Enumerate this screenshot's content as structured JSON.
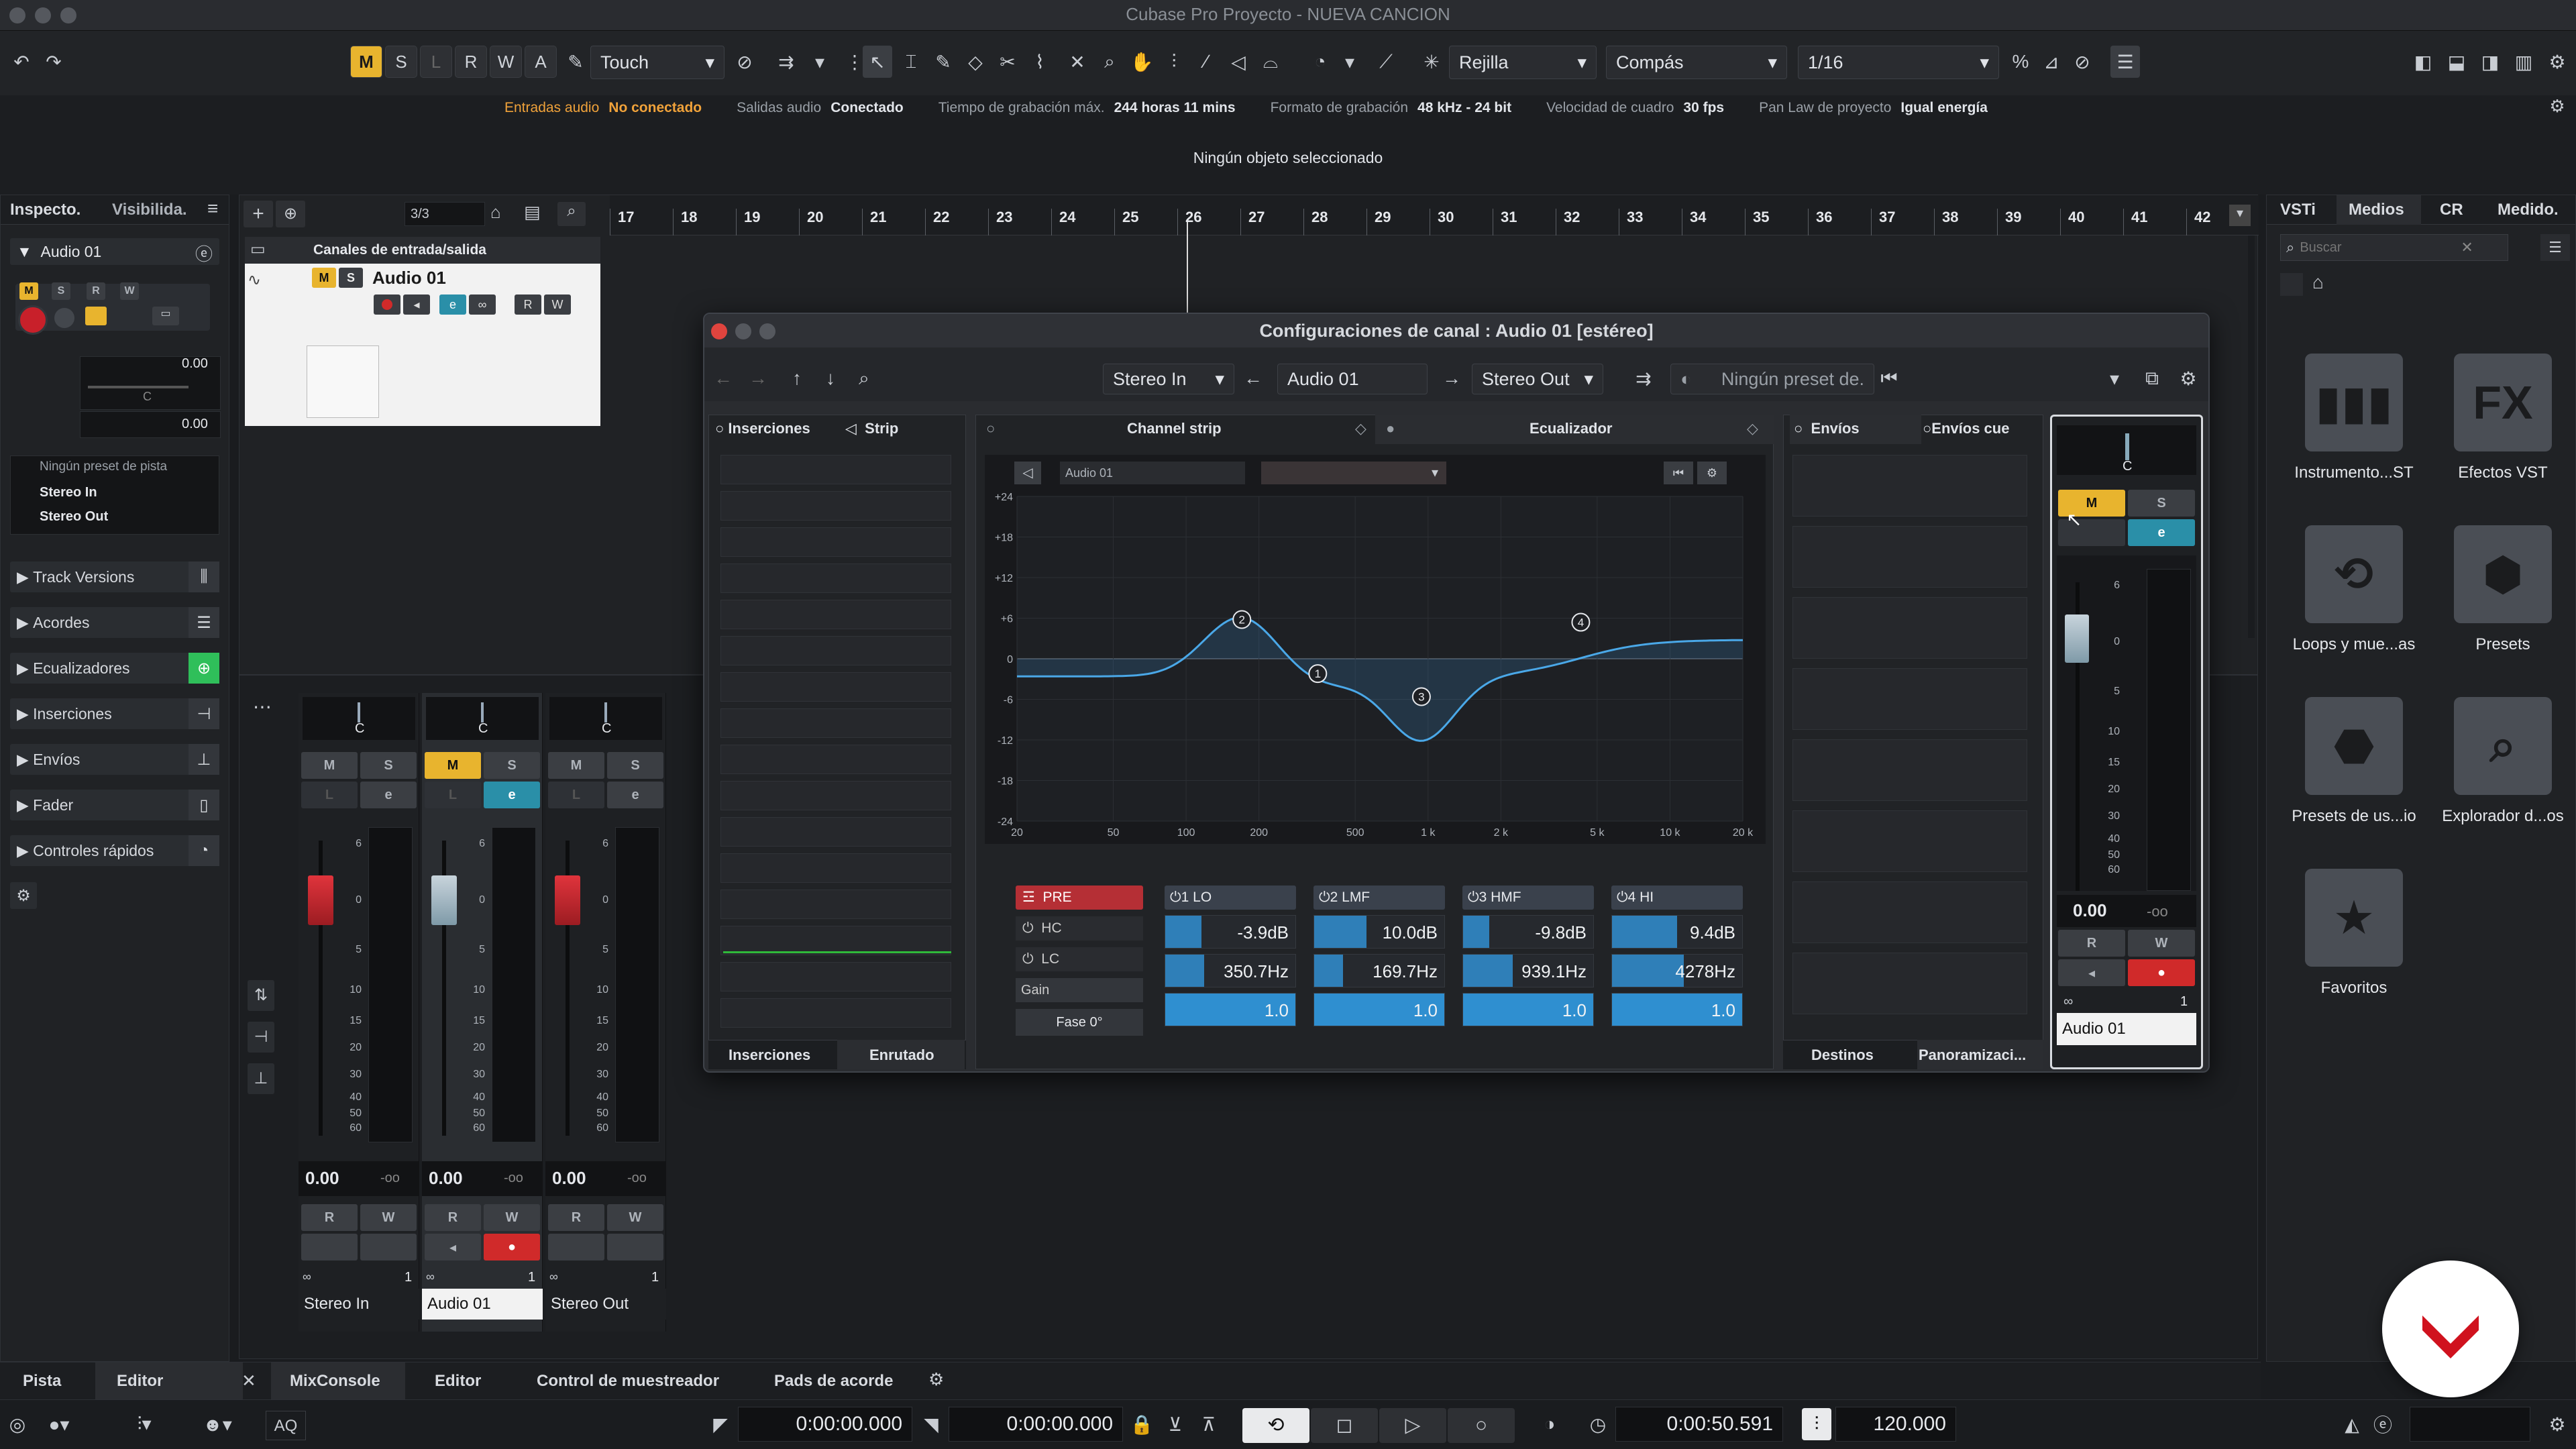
{
  "titlebar": {
    "title": "Cubase Pro Proyecto - NUEVA CANCION"
  },
  "toolbar": {
    "buttons_msrwa": [
      "M",
      "S",
      "L",
      "R",
      "W",
      "A"
    ],
    "automation_mode": "Touch",
    "grid_type": "Rejilla",
    "grid_mode": "Compás",
    "quantize": "1/16"
  },
  "status": {
    "audio_in_label": "Entradas audio",
    "audio_in_value": "No conectado",
    "audio_out_label": "Salidas audio",
    "audio_out_value": "Conectado",
    "rec_time_label": "Tiempo de grabación máx.",
    "rec_time_value": "244 horas 11 mins",
    "rec_format_label": "Formato de grabación",
    "rec_format_value": "48 kHz - 24 bit",
    "framerate_label": "Velocidad de cuadro",
    "framerate_value": "30 fps",
    "panlaw_label": "Pan Law de proyecto",
    "panlaw_value": "Igual energía"
  },
  "infoline": {
    "text": "Ningún objeto seleccionado"
  },
  "inspector": {
    "tab_inspector": "Inspecto.",
    "tab_visibility": "Visibilida.",
    "track_name": "Audio 01",
    "volume": "0.00",
    "pan": "C",
    "vol2": "0.00",
    "preset": "Ningún preset de pista",
    "input": "Stereo In",
    "output": "Stereo Out",
    "sections": [
      "Track Versions",
      "Acordes",
      "Ecualizadores",
      "Inserciones",
      "Envíos",
      "Fader",
      "Controles rápidos"
    ]
  },
  "project": {
    "track_count": "3/3",
    "folder": "Canales de entrada/salida",
    "track": "Audio 01",
    "ruler": [
      "17",
      "18",
      "19",
      "20",
      "21",
      "22",
      "23",
      "24",
      "25",
      "26",
      "27",
      "28",
      "29",
      "30",
      "31",
      "32",
      "33",
      "34",
      "35",
      "36",
      "37",
      "38",
      "39",
      "40",
      "41",
      "42"
    ]
  },
  "mixer": {
    "channels": [
      {
        "name": "Stereo In",
        "value": "0.00",
        "peak": "-oo",
        "pan": "C",
        "num": "1"
      },
      {
        "name": "Audio 01",
        "value": "0.00",
        "peak": "-oo",
        "pan": "C",
        "num": "1"
      },
      {
        "name": "Stereo Out",
        "value": "0.00",
        "peak": "-oo",
        "pan": "C",
        "num": "1"
      }
    ],
    "scale": [
      "6",
      "0",
      "5",
      "10",
      "15",
      "20",
      "30",
      "40",
      "50",
      "60"
    ]
  },
  "dialog": {
    "title": "Configuraciones de canal : Audio 01 [estéreo]",
    "input": "Stereo In",
    "channel": "Audio 01",
    "output": "Stereo Out",
    "preset": "Ningún preset de.",
    "tab_inserts": "Inserciones",
    "tab_strip": "Strip",
    "tab_channelstrip": "Channel strip",
    "tab_eq": "Ecualizador",
    "tab_sends": "Envíos",
    "tab_cuesends": "Envíos cue",
    "bottom_inserts": "Inserciones",
    "bottom_routing": "Enrutado",
    "bottom_dest": "Destinos",
    "bottom_pan": "Panoramizaci...",
    "eq_channel": "Audio 01",
    "eq_db": [
      "+24",
      "+18",
      "+12",
      "+6",
      "0",
      "-6",
      "-12",
      "-18",
      "-24"
    ],
    "eq_hz": [
      "20",
      "50",
      "100",
      "200",
      "500",
      "1 k",
      "2 k",
      "5 k",
      "10 k",
      "20 k"
    ],
    "pre": "PRE",
    "hc": "HC",
    "lc": "LC",
    "gain": "Gain",
    "phase": "Fase 0°",
    "bands": [
      {
        "name": "1 LO",
        "gain": "-3.9dB",
        "freq": "350.7Hz",
        "q": "1.0",
        "gain_fill": 0.28,
        "freq_fill": 0.3
      },
      {
        "name": "2 LMF",
        "gain": "10.0dB",
        "freq": "169.7Hz",
        "q": "1.0",
        "gain_fill": 0.4,
        "freq_fill": 0.22
      },
      {
        "name": "3 HMF",
        "gain": "-9.8dB",
        "freq": "939.1Hz",
        "q": "1.0",
        "gain_fill": 0.2,
        "freq_fill": 0.38
      },
      {
        "name": "4 HI",
        "gain": "9.4dB",
        "freq": "4278Hz",
        "q": "1.0",
        "gain_fill": 0.5,
        "freq_fill": 0.55
      }
    ],
    "eq_points": [
      {
        "id": "1",
        "freq": 350,
        "db": -2.2
      },
      {
        "id": "2",
        "freq": 170,
        "db": 5.8
      },
      {
        "id": "3",
        "freq": 939,
        "db": -5.6
      },
      {
        "id": "4",
        "freq": 4278,
        "db": 5.4
      }
    ],
    "mini_pan": "C",
    "mini_value": "0.00",
    "mini_peak": "-oo",
    "mini_name": "Audio 01",
    "mini_num": "1",
    "mini_scale": [
      "6",
      "0",
      "5",
      "10",
      "15",
      "20",
      "30",
      "40",
      "50",
      "60"
    ]
  },
  "media": {
    "tabs": [
      "VSTi",
      "Medios",
      "CR",
      "Medido."
    ],
    "search_placeholder": "Buscar",
    "items": [
      {
        "label": "Instrumento...ST",
        "icon": "piano-keys-icon"
      },
      {
        "label": "Efectos VST",
        "icon": "fx-icon"
      },
      {
        "label": "Loops y mue...as",
        "icon": "loop-icon"
      },
      {
        "label": "Presets",
        "icon": "presets-icon"
      },
      {
        "label": "Presets de us...io",
        "icon": "user-presets-icon"
      },
      {
        "label": "Explorador d...os",
        "icon": "file-explorer-icon"
      },
      {
        "label": "Favoritos",
        "icon": "star-icon"
      }
    ]
  },
  "bottom": {
    "tab_track": "Pista",
    "tab_editor": "Editor",
    "zone_tabs": [
      "MixConsole",
      "Editor",
      "Control de muestreador",
      "Pads de acorde"
    ],
    "left_locator": "0:00:00.000",
    "right_locator": "0:00:00.000",
    "position": "0:00:50.591",
    "tempo": "120.000",
    "aq": "AQ"
  }
}
